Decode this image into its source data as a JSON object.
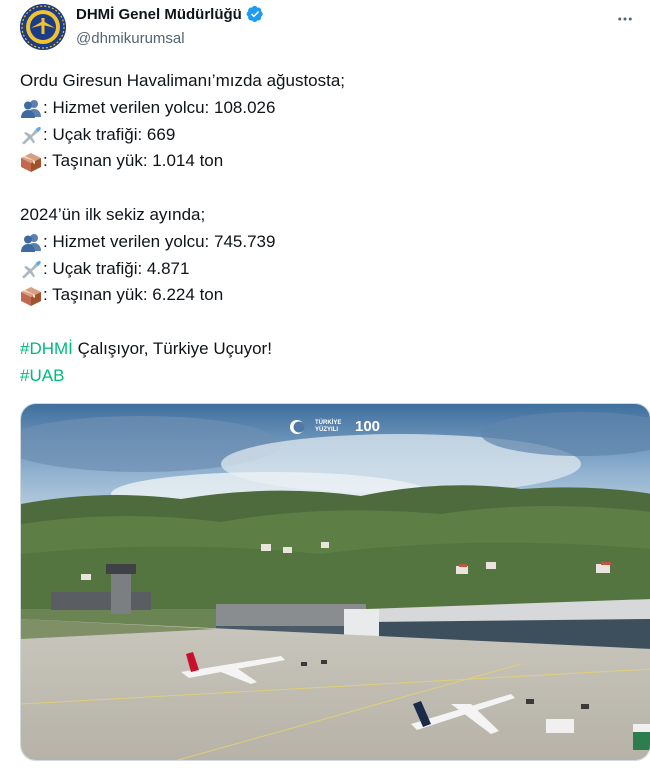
{
  "author": {
    "display_name": "DHMİ Genel Müdürlüğü",
    "handle": "@dhmikurumsal",
    "avatar_icon": "dhmi-logo",
    "verified": true,
    "verified_color": "#1d9bf0"
  },
  "menu": {
    "icon": "more-horizontal-icon"
  },
  "post": {
    "intro": "Ordu Giresun Havalimanı’mızda ağustosta;",
    "august": [
      {
        "icon": "people-icon",
        "text": ": Hizmet verilen yolcu: 108.026"
      },
      {
        "icon": "airplane-icon",
        "text": ": Uçak trafiği: 669"
      },
      {
        "icon": "package-icon",
        "text": ": Taşınan yük: 1.014 ton"
      }
    ],
    "period_title": "2024’ün ilk sekiz ayında;",
    "eight_months": [
      {
        "icon": "people-icon",
        "text": ": Hizmet verilen yolcu: 745.739"
      },
      {
        "icon": "airplane-icon",
        "text": ": Uçak trafiği: 4.871"
      },
      {
        "icon": "package-icon",
        "text": ": Taşınan yük: 6.224 ton"
      }
    ],
    "hashtag_1": "#DHMİ",
    "tagline": " Çalışıyor, Türkiye Uçuyor!",
    "hashtag_2": "#UAB",
    "hashtag_color": "#00ba7c"
  },
  "media": {
    "logo_text": "TÜRKİYE YÜZYILI",
    "badge_text": "100"
  }
}
